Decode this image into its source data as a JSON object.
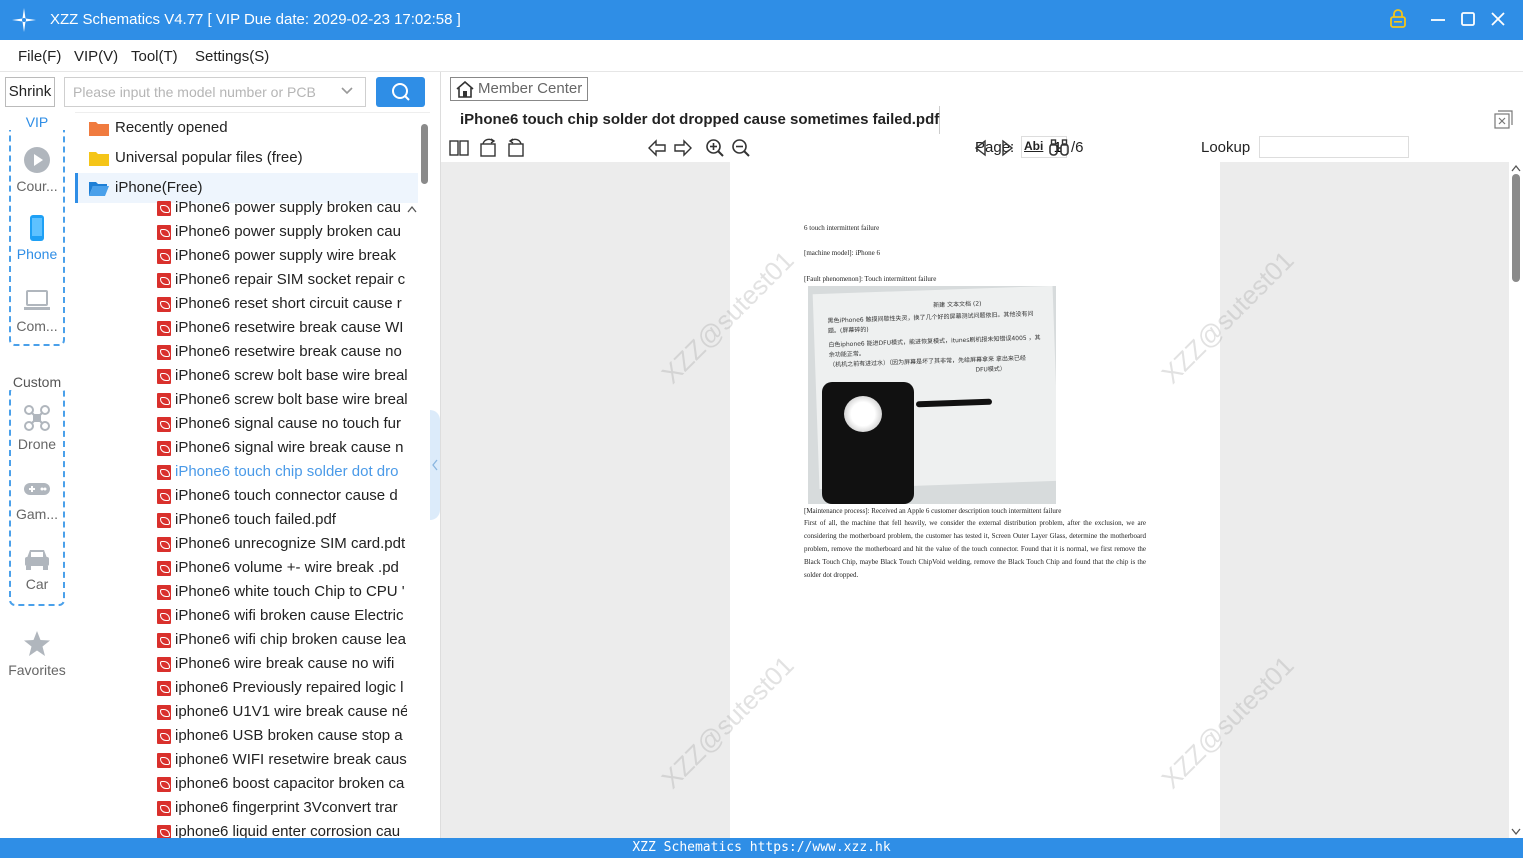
{
  "window": {
    "title": "XZZ Schematics V4.77 [ VIP Due date: 2029-02-23 17:02:58 ]",
    "controls": [
      "lock-icon",
      "minimize-icon",
      "maximize-icon",
      "close-icon"
    ]
  },
  "menu": {
    "file": "File(F)",
    "vip": "VIP(V)",
    "tool": "Tool(T)",
    "settings": "Settings(S)"
  },
  "search": {
    "shrink_label": "Shrink",
    "placeholder": "Please input the model number or PCB"
  },
  "rail": {
    "vip_label": "VIP",
    "custom_label": "Custom",
    "items": [
      {
        "label": "Cour...",
        "icon": "play-icon"
      },
      {
        "label": "Phone",
        "icon": "phone-icon",
        "active": true
      },
      {
        "label": "Com...",
        "icon": "laptop-icon"
      },
      {
        "label": "Drone",
        "icon": "drone-icon"
      },
      {
        "label": "Gam...",
        "icon": "gamepad-icon"
      },
      {
        "label": "Car",
        "icon": "car-icon"
      },
      {
        "label": "Favorites",
        "icon": "star-icon"
      }
    ]
  },
  "tree": {
    "folders": [
      {
        "label": "Recently opened",
        "color": "#f07b3f"
      },
      {
        "label": "Universal popular files (free)",
        "color": "#f5c518"
      },
      {
        "label": "iPhone(Free)",
        "color": "#2f8ee6"
      }
    ],
    "files": [
      "iPhone6 power supply broken cau",
      "iPhone6 power supply broken cau",
      "iPhone6 power supply wire break",
      "iPhone6 repair SIM socket repair c",
      "iPhone6 reset short circuit cause  r",
      "iPhone6 resetwire break  cause WI",
      "iPhone6 resetwire break  cause no",
      "iPhone6 screw bolt base wire breal",
      "iPhone6 screw bolt base wire breal",
      "iPhone6 signal cause no touch fur",
      "iPhone6 signal wire break  cause n",
      "iPhone6 touch chip solder dot dro",
      "iPhone6 touch connector cause  d",
      "iPhone6 touch failed.pdf",
      "iPhone6 unrecognize SIM card.pdt",
      "iPhone6 volume +- wire break .pd",
      "iPhone6 white touch Chip to CPU '",
      "iPhone6 wifi broken cause Electric",
      "iPhone6 wifi chip broken cause lea",
      "iPhone6 wire break  cause no wifi",
      "iphone6 Previously repaired logic l",
      "iphone6 U1V1 wire break  cause né",
      "iphone6 USB broken cause  stop a",
      "iphone6 WIFI resetwire break  caus",
      "iphone6 boost capacitor broken ca",
      "iphone6 fingerprint 3Vconvert trar",
      "iphone6 liquid enter corrosion cau"
    ],
    "selected_index": 11
  },
  "viewer": {
    "member_center": "Member Center",
    "document_tab": "iPhone6 touch chip solder dot dropped cause sometimes failed.pdf",
    "page_label": "Page:",
    "page_current": "1",
    "page_total": "/6",
    "lookup_label": "Lookup",
    "find_abi": "Abi"
  },
  "document": {
    "heading": "6 touch intermittent failure",
    "model": "[machine model]: iPhone 6",
    "fault": "[Fault phenomenon]: Touch intermittent failure",
    "photo_lines": [
      "新建 文本文档 (2)",
      "黑色iPhone6 触摸间歇性失灵，换了几个好的屏幕测试问题依旧。其他没有问",
      "题。(屏幕碎的)",
      "白色iphone6 能进DFU模式，能进恢复模式，itunes刷机报未知错误4005 ，其",
      "余功能正常。",
      "（机机之前有进过水）（因为屏幕是坏了其非常，先给屏幕拿来 拿出来已经",
      "DFU模式）"
    ],
    "process_title": "[Maintenance process]: Received an Apple 6 customer description touch intermittent failure",
    "process_body": "First of all, the machine that fell heavily, we consider the external distribution problem, after the exclusion, we are considering the motherboard problem, the customer has tested it, Screen Outer Layer Glass, determine the motherboard problem, remove the motherboard and hit the value of the touch connector. Found that it is normal, we first remove the Black Touch Chip, maybe Black Touch ChipVoid welding, remove the Black Touch Chip and found that the chip is the solder dot dropped.",
    "watermark": "XZZ@sutest01"
  },
  "status": {
    "text": "XZZ Schematics https://www.xzz.hk"
  },
  "colors": {
    "accent": "#2f8ee6",
    "selected_file": "#4a9ae8",
    "pdf_icon": "#d9302c"
  }
}
